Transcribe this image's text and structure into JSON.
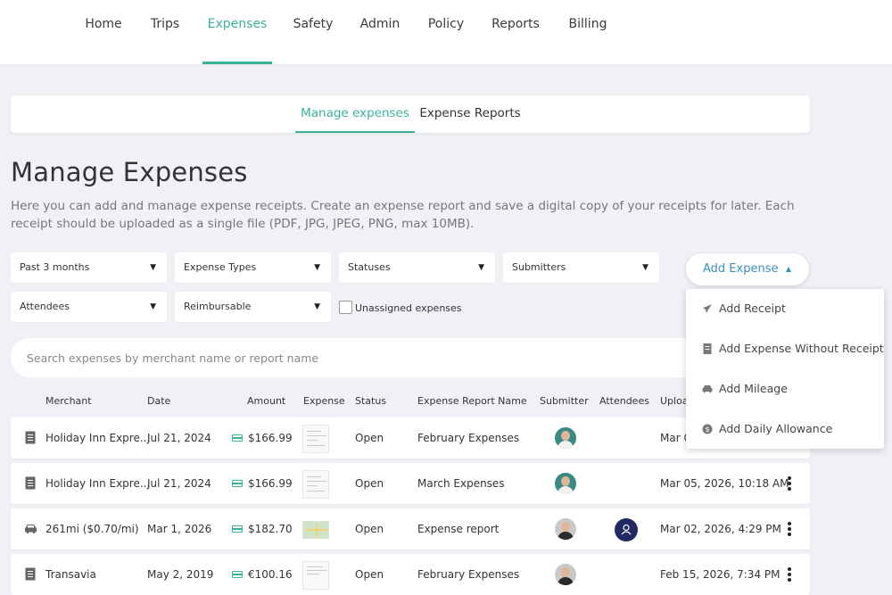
{
  "nav": {
    "items": [
      "Home",
      "Trips",
      "Expenses",
      "Safety",
      "Admin",
      "Policy",
      "Reports",
      "Billing"
    ]
  },
  "subtabs": [
    "Manage expenses",
    "Expense Reports"
  ],
  "page": {
    "title": "Manage Expenses",
    "description": "Here you can add and manage expense receipts. Create an expense report and save a digital copy of your receipts for later. Each receipt should be uploaded as a single file (PDF, JPG, JPEG, PNG, max 10MB)."
  },
  "filters": {
    "period": "Past 3 months",
    "expense_types": "Expense Types",
    "statuses": "Statuses",
    "submitters": "Submitters",
    "attendees": "Attendees",
    "reimbursable": "Reimbursable",
    "unassigned_label": "Unassigned expenses"
  },
  "add_expense": {
    "label": "Add Expense",
    "menu": [
      "Add Receipt",
      "Add Expense Without Receipt",
      "Add Mileage",
      "Add Daily Allowance"
    ]
  },
  "search": {
    "placeholder": "Search expenses by merchant name or report name"
  },
  "table": {
    "headers": [
      "Merchant",
      "Date",
      "Amount",
      "Expense",
      "Status",
      "Expense Report Name",
      "Submitter",
      "Attendees",
      "Uploa"
    ],
    "rows": [
      {
        "merchant": "Holiday Inn Expre...",
        "date": "Jul 21, 2024",
        "amount": "$166.99",
        "status": "Open",
        "report": "February Expenses",
        "uploaded": "Mar 0"
      },
      {
        "merchant": "Holiday Inn Expre...",
        "date": "Jul 21, 2024",
        "amount": "$166.99",
        "status": "Open",
        "report": "March Expenses",
        "uploaded": "Mar 05, 2026, 10:18 AM"
      },
      {
        "merchant": "261mi ($0.70/mi)",
        "date": "Mar 1, 2026",
        "amount": "$182.70",
        "status": "Open",
        "report": "Expense report",
        "uploaded": "Mar 02, 2026, 4:29 PM"
      },
      {
        "merchant": "Transavia",
        "date": "May 2, 2019",
        "amount": "€100.16",
        "status": "Open",
        "report": "February Expenses",
        "uploaded": "Feb 15, 2026, 7:34 PM"
      }
    ]
  },
  "colors": {
    "accent": "#3bb39b",
    "link_blue": "#3a8fbf",
    "background": "#f0f1f6"
  }
}
